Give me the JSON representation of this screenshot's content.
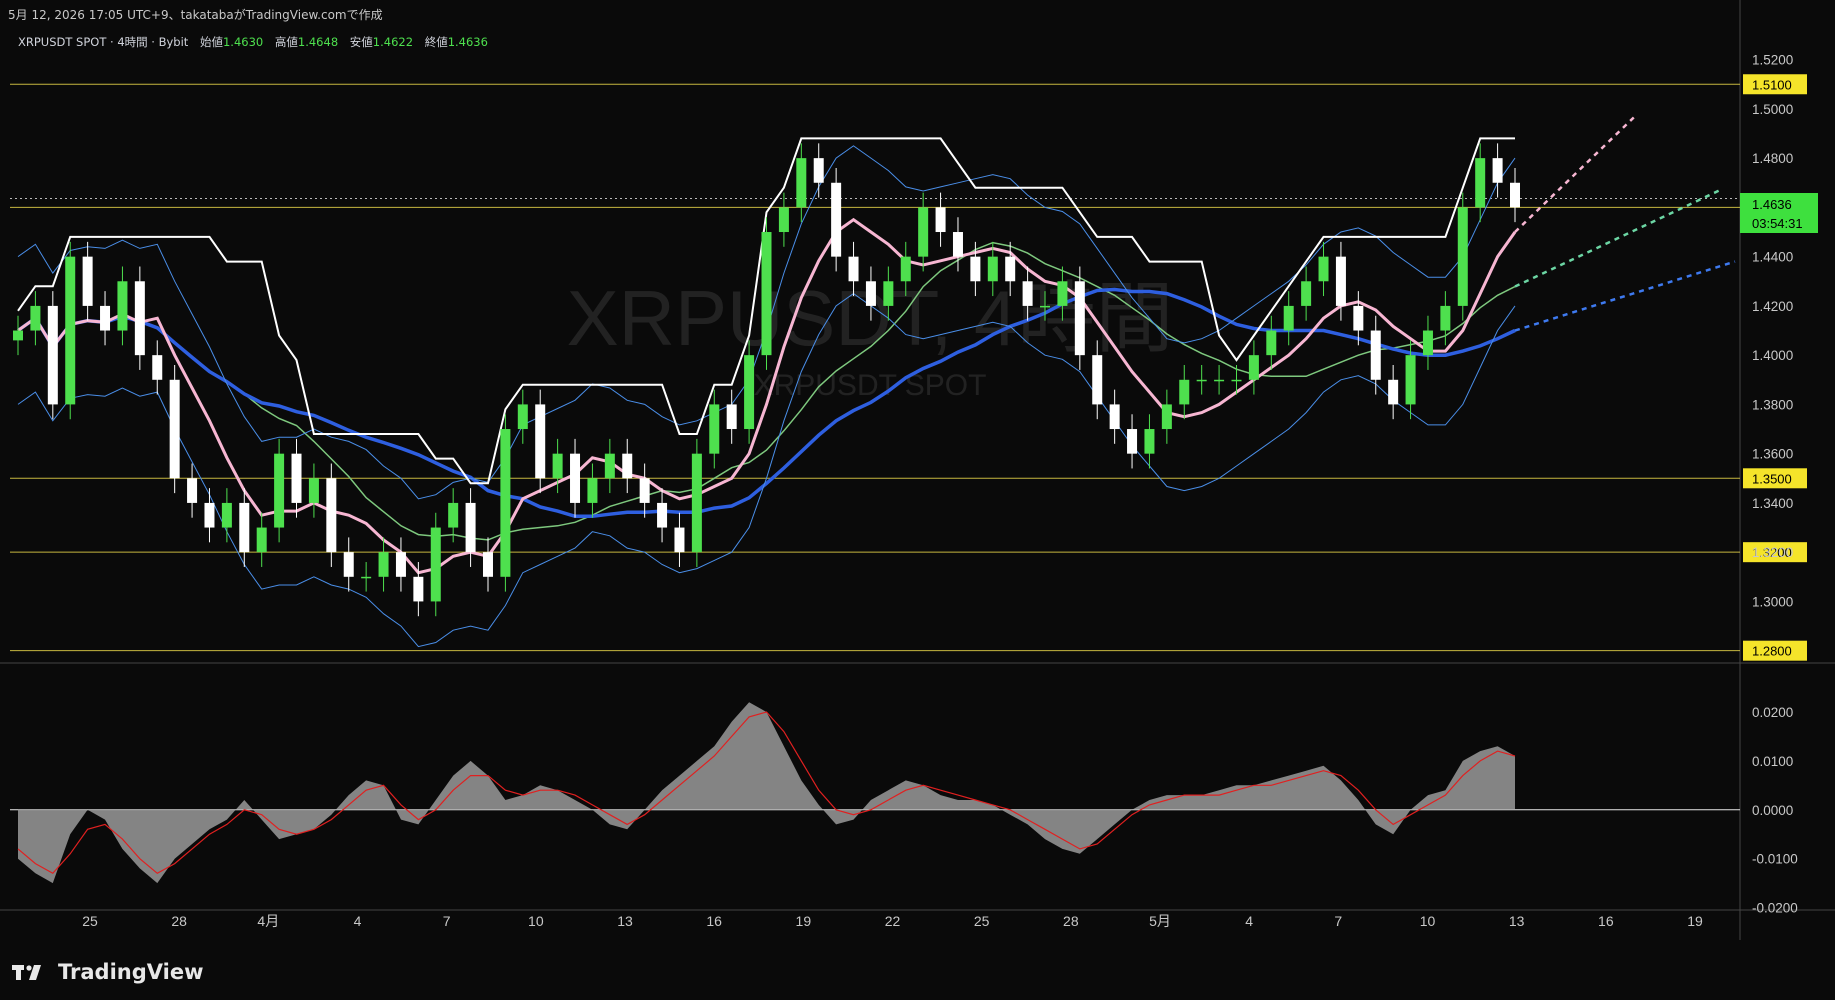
{
  "header": {
    "caption": "5月 12, 2026 17:05 UTC+9、takatabaがTradingView.comで作成"
  },
  "symbol_line": {
    "name": "XRPUSDT SPOT · 4時間 · Bybit",
    "open_label": "始値",
    "open": "1.4630",
    "high_label": "高値",
    "high": "1.4648",
    "low_label": "安値",
    "low": "1.4622",
    "close_label": "終値",
    "close": "1.4636"
  },
  "watermark": {
    "main": "XRPUSDT, 4時間",
    "sub": "XRPUSDT SPOT"
  },
  "price_badge": {
    "price": "1.4636",
    "countdown": "03:54:31"
  },
  "footer": {
    "brand": "TradingView"
  },
  "colors": {
    "background": "#0a0a0a",
    "up": "#4ee04e",
    "down": "#ffffff",
    "level": "#e8d64a",
    "ma_blue": "#2e5fe0",
    "ma_pink": "#f7b6d2",
    "ma_green": "#7ec87e",
    "ichimoku_band": "#ffffff",
    "bollinger": "#4a8ee8",
    "osc_fill": "#9a9a9a",
    "osc_signal": "#e02020"
  },
  "chart_data": [
    {
      "type": "line",
      "title": "XRPUSDT SPOT · 4時間 · Bybit",
      "x_ticks": [
        "25",
        "28",
        "4月",
        "4",
        "7",
        "10",
        "13",
        "16",
        "19",
        "22",
        "25",
        "28",
        "5月",
        "4",
        "7",
        "10",
        "13",
        "16",
        "19"
      ],
      "ylim": [
        1.275,
        1.53
      ],
      "y_ticks": [
        "1.5200",
        "1.5000",
        "1.4800",
        "1.4600",
        "1.4400",
        "1.4200",
        "1.4000",
        "1.3800",
        "1.3600",
        "1.3400",
        "1.3200",
        "1.3000"
      ],
      "levels": [
        "1.5100",
        "1.4600",
        "1.3500",
        "1.3200",
        "1.2800"
      ],
      "last_price": 1.4636,
      "series": [
        {
          "name": "",
          "values": [
            1.41,
            1.42,
            1.38,
            1.44,
            1.42,
            1.41,
            1.43,
            1.4,
            1.39,
            1.35,
            1.34,
            1.33,
            1.34,
            1.32,
            1.33,
            1.36,
            1.34,
            1.35,
            1.32,
            1.31,
            1.31,
            1.32,
            1.31,
            1.3,
            1.33,
            1.34,
            1.32,
            1.31,
            1.37,
            1.38,
            1.35,
            1.36,
            1.34,
            1.35,
            1.36,
            1.35,
            1.34,
            1.33,
            1.32,
            1.36,
            1.38,
            1.37,
            1.4,
            1.45,
            1.46,
            1.48,
            1.47,
            1.44,
            1.43,
            1.42,
            1.43,
            1.44,
            1.46,
            1.45,
            1.44,
            1.43,
            1.44,
            1.43,
            1.42,
            1.42,
            1.43,
            1.4,
            1.38,
            1.37,
            1.36,
            1.37,
            1.38,
            1.39,
            1.39,
            1.39,
            1.39,
            1.4,
            1.41,
            1.42,
            1.43,
            1.44,
            1.42,
            1.41,
            1.39,
            1.38,
            1.4,
            1.41,
            1.42,
            1.46,
            1.48,
            1.47,
            1.46
          ]
        }
      ]
    },
    {
      "type": "area",
      "title": "",
      "ylim": [
        -0.0205,
        0.0245
      ],
      "y_ticks": [
        "0.0200",
        "0.0100",
        "0.0000",
        "-0.0100",
        "-0.0200"
      ],
      "series": [
        {
          "name": "",
          "values": [
            -0.01,
            -0.013,
            -0.015,
            -0.005,
            0.0,
            -0.002,
            -0.008,
            -0.012,
            -0.015,
            -0.01,
            -0.007,
            -0.004,
            -0.002,
            0.002,
            -0.002,
            -0.006,
            -0.005,
            -0.004,
            -0.001,
            0.003,
            0.006,
            0.005,
            -0.002,
            -0.003,
            0.002,
            0.007,
            0.01,
            0.007,
            0.002,
            0.003,
            0.005,
            0.004,
            0.002,
            0.0,
            -0.003,
            -0.004,
            0.0,
            0.004,
            0.007,
            0.01,
            0.013,
            0.018,
            0.022,
            0.02,
            0.013,
            0.006,
            0.001,
            -0.003,
            -0.002,
            0.002,
            0.004,
            0.006,
            0.005,
            0.003,
            0.002,
            0.002,
            0.001,
            -0.001,
            -0.003,
            -0.006,
            -0.008,
            -0.009,
            -0.006,
            -0.003,
            0.0,
            0.002,
            0.003,
            0.003,
            0.003,
            0.004,
            0.005,
            0.005,
            0.006,
            0.007,
            0.008,
            0.009,
            0.006,
            0.002,
            -0.003,
            -0.005,
            0.0,
            0.003,
            0.004,
            0.01,
            0.012,
            0.013,
            0.011
          ]
        },
        {
          "name": "",
          "values": [
            -0.008,
            -0.011,
            -0.013,
            -0.009,
            -0.004,
            -0.003,
            -0.006,
            -0.01,
            -0.013,
            -0.011,
            -0.008,
            -0.005,
            -0.003,
            0.0,
            -0.001,
            -0.004,
            -0.005,
            -0.004,
            -0.002,
            0.001,
            0.004,
            0.005,
            0.001,
            -0.002,
            0.0,
            0.004,
            0.007,
            0.007,
            0.004,
            0.003,
            0.004,
            0.004,
            0.003,
            0.001,
            -0.001,
            -0.003,
            -0.001,
            0.002,
            0.005,
            0.008,
            0.011,
            0.015,
            0.019,
            0.02,
            0.016,
            0.01,
            0.004,
            0.0,
            -0.001,
            0.0,
            0.002,
            0.004,
            0.005,
            0.004,
            0.003,
            0.002,
            0.001,
            0.0,
            -0.002,
            -0.004,
            -0.006,
            -0.008,
            -0.007,
            -0.004,
            -0.001,
            0.001,
            0.002,
            0.003,
            0.003,
            0.003,
            0.004,
            0.005,
            0.005,
            0.006,
            0.007,
            0.008,
            0.007,
            0.004,
            0.0,
            -0.003,
            -0.001,
            0.001,
            0.003,
            0.007,
            0.01,
            0.012,
            0.011
          ]
        }
      ]
    }
  ]
}
